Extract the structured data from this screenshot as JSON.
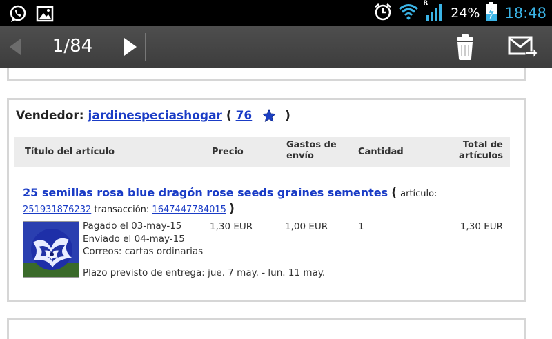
{
  "status_bar": {
    "battery_percent": "24%",
    "time": "18:48",
    "roaming_indicator": "R",
    "icons": [
      "whatsapp-icon",
      "gallery-icon",
      "alarm-icon",
      "wifi-icon",
      "signal-icon",
      "battery-charging-icon"
    ]
  },
  "action_bar": {
    "counter": "1/84",
    "icons": [
      "prev-arrow-icon",
      "next-arrow-icon",
      "trash-icon",
      "forward-mail-icon"
    ]
  },
  "order": {
    "seller_label": "Vendedor:",
    "seller_name": "jardinespeciashogar",
    "paren_open": "(",
    "paren_close": ")",
    "feedback_score": "76",
    "star_color": "#1c3fc2",
    "table_headers": {
      "title": "Título del artículo",
      "price": "Precio",
      "shipping_line1": "Gastos de",
      "shipping_line2": "envío",
      "quantity": "Cantidad",
      "total_line1": "Total de",
      "total_line2": "artículos"
    },
    "item": {
      "title": "25 semillas rosa blue dragón rose seeds graines sementes",
      "paren_open": "(",
      "paren_close": ")",
      "article_label": "artículo:",
      "article_number": "251931876232",
      "transaction_label": "transacción:",
      "transaction_number": "1647447784015",
      "paid": "Pagado el 03-may-15",
      "shipped": "Enviado el 04-may-15",
      "shipping_method": "Correos: cartas ordinarias",
      "delivery_estimate": "Plazo previsto de entrega: jue. 7 may. - lun. 11 may.",
      "price": "1,30 EUR",
      "shipping_cost": "1,00 EUR",
      "quantity": "1",
      "total": "1,30 EUR"
    }
  },
  "colors": {
    "link": "#1a3cc6",
    "clock": "#3bb4e6",
    "action_bar": "#454545",
    "header_bg": "#ececec",
    "border": "#d6d6d6"
  }
}
